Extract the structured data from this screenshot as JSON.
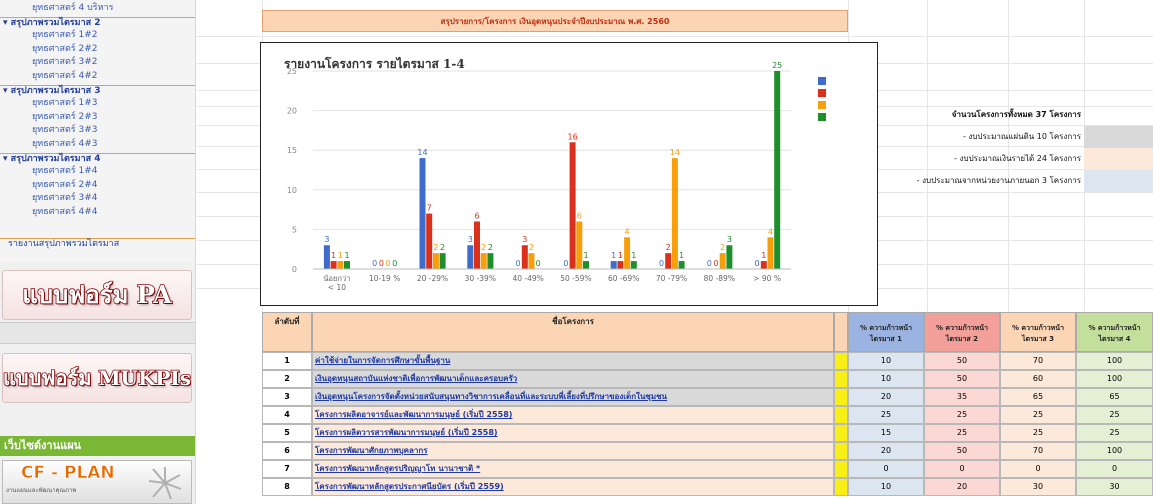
{
  "sidebar": {
    "nav": [
      {
        "label": "ยุทธศาสตร์ 4 บริหาร",
        "kind": "sub"
      },
      {
        "label": "▾ สรุปภาพรวมไตรมาส 2",
        "kind": "head"
      },
      {
        "label": "ยุทธศาสตร์ 1#2",
        "kind": "sub"
      },
      {
        "label": "ยุทธศาสตร์ 2#2",
        "kind": "sub"
      },
      {
        "label": "ยุทธศาสตร์ 3#2",
        "kind": "sub"
      },
      {
        "label": "ยุทธศาสตร์ 4#2",
        "kind": "sub"
      },
      {
        "label": "▾ สรุปภาพรวมไตรมาส 3",
        "kind": "head"
      },
      {
        "label": "ยุทธศาสตร์ 1#3",
        "kind": "sub"
      },
      {
        "label": "ยุทธศาสตร์ 2#3",
        "kind": "sub"
      },
      {
        "label": "ยุทธศาสตร์ 3#3",
        "kind": "sub"
      },
      {
        "label": "ยุทธศาสตร์ 4#3",
        "kind": "sub"
      },
      {
        "label": "▾ สรุปภาพรวมไตรมาส 4",
        "kind": "head"
      },
      {
        "label": "ยุทธศาสตร์ 1#4",
        "kind": "sub"
      },
      {
        "label": "ยุทธศาสตร์ 2#4",
        "kind": "sub"
      },
      {
        "label": "ยุทธศาสตร์ 3#4",
        "kind": "sub"
      },
      {
        "label": "ยุทธศาสตร์ 4#4",
        "kind": "sub"
      },
      {
        "label": "รายงานสรุปภาพรวมไตรมาส",
        "kind": "summary"
      }
    ],
    "banner_pa": "แบบฟอร์ม PA",
    "banner_mukpi": "แบบฟอร์ม MUKPIs",
    "web_heading": "เว็บไซต์งานแผน",
    "cfplan_title": "CF - PLAN",
    "cfplan_sub": "งานแผนและพัฒนาคุณภาพ"
  },
  "sheet": {
    "title": "สรุปรายการ/โครงการ เงินอุดหนุนประจำปีงบประมาณ พ.ศ. 2560",
    "info": [
      {
        "text": "จำนวนโครงการทั้งหมด 37 โครงการ",
        "bold": true,
        "swatch": ""
      },
      {
        "text": "- งบประมาณแผ่นดิน 10 โครงการ",
        "bold": false,
        "swatch": "#d9d9d9"
      },
      {
        "text": "- งบประมาณเงินรายได้ 24 โครงการ",
        "bold": false,
        "swatch": "#fde9d9"
      },
      {
        "text": "- งบประมาณจากหน่วยงานภายนอก 3 โครงการ",
        "bold": false,
        "swatch": "#dce6f1"
      }
    ],
    "table": {
      "headers": {
        "no": "ลำดับที่",
        "name": "ชื่อโครงการ",
        "q1": "% ความก้าวหน้า ไตรมาส 1",
        "q2": "% ความก้าวหน้า ไตรมาส 2",
        "q3": "% ความก้าวหน้า ไตรมาส 3",
        "q4": "% ความก้าวหน้า ไตรมาส 4"
      },
      "header_colors": {
        "q1": "#9bb3e0",
        "q2": "#f4a09a",
        "q3": "#fbd5b4",
        "q4": "#c4df9c"
      },
      "rows": [
        {
          "no": "1",
          "name": "ค่าใช้จ่ายในการจัดการศึกษาขั้นพื้นฐาน",
          "q1": "10",
          "q2": "50",
          "q3": "70",
          "q4": "100",
          "bg": "#d9d9d9"
        },
        {
          "no": "2",
          "name": "เงินอุดหนุนสถาบันแห่งชาติเพื่อการพัฒนาเด็กและครอบครัว",
          "q1": "10",
          "q2": "50",
          "q3": "60",
          "q4": "100",
          "bg": "#d9d9d9"
        },
        {
          "no": "3",
          "name": "เงินอุดหนุนโครงการจัดตั้งหน่วยสนับสนุนทางวิชาการเคลื่อนที่และระบบพี่เลี้ยงที่ปรึกษาของเด็กในชุมชน",
          "q1": "20",
          "q2": "35",
          "q3": "65",
          "q4": "65",
          "bg": "#d9d9d9"
        },
        {
          "no": "4",
          "name": "โครงการผลิตอาจารย์และพัฒนาการมนุษย์ (เริ่มปี 2558)",
          "q1": "25",
          "q2": "25",
          "q3": "25",
          "q4": "25",
          "bg": "#fde9d9"
        },
        {
          "no": "5",
          "name": "โครงการผลิตวารสารพัฒนาการมนุษย์ (เริ่มปี 2558)",
          "q1": "15",
          "q2": "25",
          "q3": "25",
          "q4": "25",
          "bg": "#fde9d9"
        },
        {
          "no": "6",
          "name": "โครงการพัฒนาศักยภาพบุคลากร",
          "q1": "20",
          "q2": "50",
          "q3": "70",
          "q4": "100",
          "bg": "#fde9d9"
        },
        {
          "no": "7",
          "name": "โครงการพัฒนาหลักสูตรปริญญาโท นานาชาติ *",
          "q1": "0",
          "q2": "0",
          "q3": "0",
          "q4": "0",
          "bg": "#fde9d9"
        },
        {
          "no": "8",
          "name": "โครงการพัฒนาหลักสูตรประกาศนียบัตร (เริ่มปี 2559)",
          "q1": "10",
          "q2": "20",
          "q3": "30",
          "q4": "30",
          "bg": "#fde9d9"
        }
      ]
    }
  },
  "chart_data": {
    "type": "bar",
    "title": "รายงานโครงการ รายไตรมาส  1-4",
    "categories": [
      "น้อยกว่า < 10",
      "10-19 %",
      "20 -29%",
      "30 -39%",
      "40 -49%",
      "50 -59%",
      "60 -69%",
      "70 -79%",
      "80 -89%",
      "> 90 %"
    ],
    "series": [
      {
        "color": "#3f6ccb",
        "values": [
          3,
          0,
          14,
          3,
          0,
          0,
          1,
          0,
          0,
          0
        ]
      },
      {
        "color": "#d9311b",
        "values": [
          1,
          0,
          7,
          6,
          3,
          16,
          1,
          2,
          0,
          1
        ]
      },
      {
        "color": "#f79e0b",
        "values": [
          1,
          0,
          2,
          2,
          2,
          6,
          4,
          14,
          2,
          4
        ]
      },
      {
        "color": "#1f8f2c",
        "values": [
          1,
          0,
          2,
          2,
          0,
          1,
          1,
          1,
          3,
          25
        ]
      }
    ],
    "ylim": [
      0,
      25
    ],
    "yticks": [
      0,
      5,
      10,
      15,
      20,
      25
    ],
    "grid": true,
    "legend": "right"
  }
}
